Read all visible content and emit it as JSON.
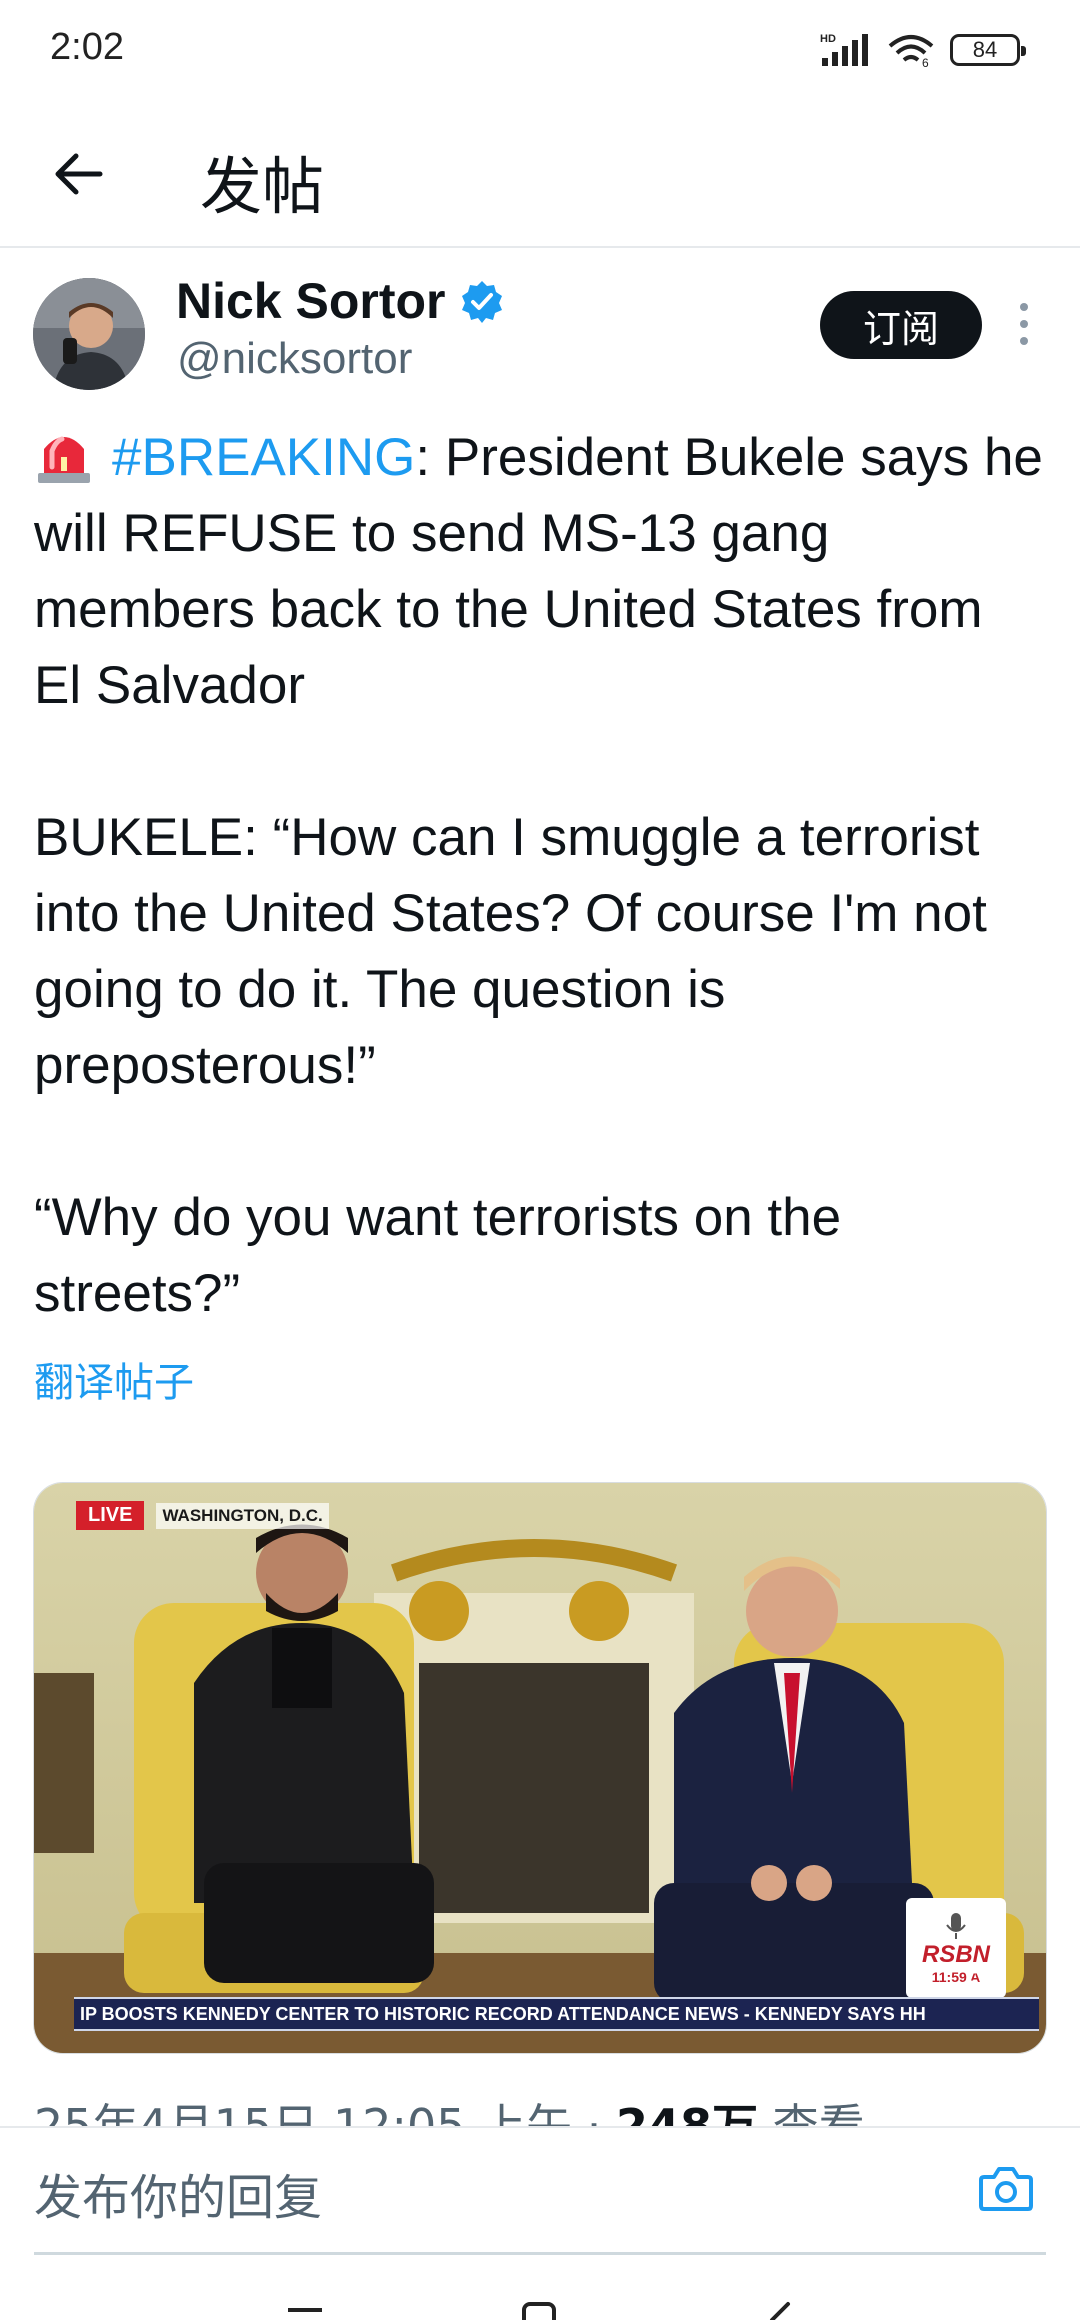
{
  "status_bar": {
    "time": "2:02",
    "signal_label": "HD",
    "wifi_label": "6",
    "battery": "84"
  },
  "header": {
    "title": "发帖",
    "back_icon": "arrow-left-icon"
  },
  "tweet": {
    "author_name": "Nick Sortor",
    "author_handle": "@nicksortor",
    "verified_color": "#1d9bf0",
    "subscribe_label": "订阅",
    "hashtag": "#BREAKING",
    "line1_rest": ": President Bukele says he will REFUSE to send MS-13 gang members back to the United States from El Salvador",
    "paragraph2": "BUKELE: “How can I smuggle a terrorist into the United States? Of course I'm not going to do it. The question is preposterous!”",
    "paragraph3": "“Why do you want terrorists on the streets?”",
    "translate_label": "翻译帖子"
  },
  "video": {
    "live_label": "LIVE",
    "location_label": "WASHINGTON, D.C.",
    "ticker_text": "IP BOOSTS KENNEDY CENTER TO HISTORIC RECORD ATTENDANCE    NEWS -    KENNEDY SAYS HH",
    "channel_logo": "RSBN",
    "clock": "11:59 A"
  },
  "meta": {
    "date_time": "25年4月15日 12:05 上午 · ",
    "views_count": "248万",
    "views_label": " 查看"
  },
  "reply_bar": {
    "placeholder": "发布你的回复"
  },
  "colors": {
    "accent": "#1d9bf0",
    "text_primary": "#0f1419",
    "text_secondary": "#536471"
  }
}
